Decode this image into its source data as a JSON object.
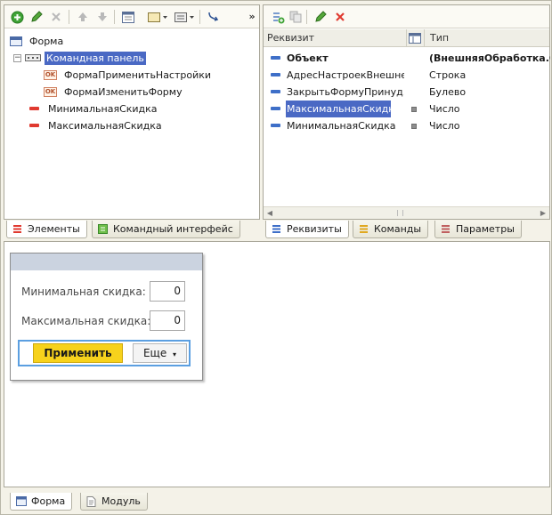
{
  "left_pane": {
    "tree": [
      {
        "label": "Форма"
      },
      {
        "label": "Командная панель"
      },
      {
        "label": "ФормаПрименитьНастройки"
      },
      {
        "label": "ФормаИзменитьФорму"
      },
      {
        "label": "МинимальнаяСкидка"
      },
      {
        "label": "МаксимальнаяСкидка"
      }
    ],
    "tabs": [
      {
        "label": "Элементы"
      },
      {
        "label": "Командный интерфейс"
      }
    ]
  },
  "right_pane": {
    "columns": {
      "name": "Реквизит",
      "type": "Тип"
    },
    "rows": [
      {
        "name": "Объект",
        "type": "(ВнешняяОбработка.Ск"
      },
      {
        "name": "АдресНастроекВнешне...",
        "type": "Строка"
      },
      {
        "name": "ЗакрытьФормуПринуд...",
        "type": "Булево"
      },
      {
        "name": "МаксимальнаяСкидка",
        "type": "Число"
      },
      {
        "name": "МинимальнаяСкидка",
        "type": "Число"
      }
    ],
    "tabs": [
      {
        "label": "Реквизиты"
      },
      {
        "label": "Команды"
      },
      {
        "label": "Параметры"
      }
    ]
  },
  "form_preview": {
    "fields": [
      {
        "label": "Минимальная скидка:",
        "value": "0"
      },
      {
        "label": "Максимальная скидка:",
        "value": "0"
      }
    ],
    "apply_label": "Применить",
    "more_label": "Еще",
    "more_arrow": "▾"
  },
  "bottom_tabs": [
    {
      "label": "Форма"
    },
    {
      "label": "Модуль"
    }
  ],
  "colors": {
    "selection": "#4a69c4",
    "apply_button": "#f7d21c",
    "focus_border": "#5b9fe1",
    "delete_icon": "#e03a30"
  }
}
